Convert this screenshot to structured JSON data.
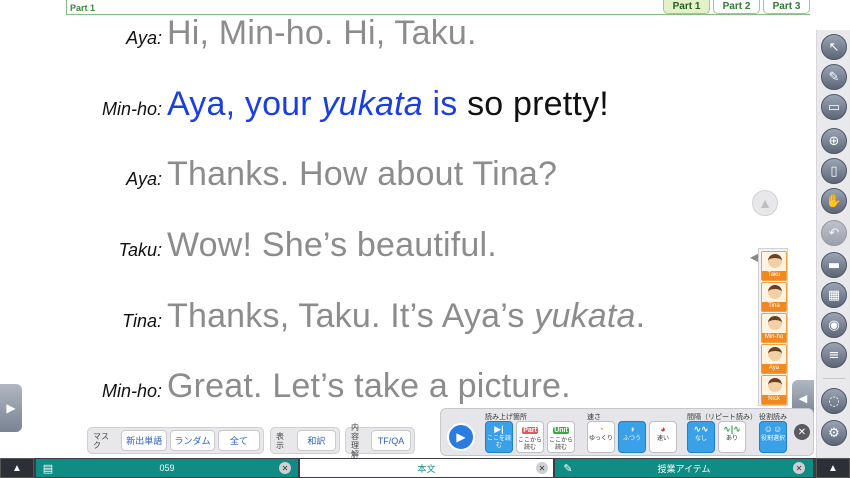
{
  "header": {
    "part_tag": "Part 1",
    "tabs": [
      {
        "label": "Part 1",
        "active": true
      },
      {
        "label": "Part 2",
        "active": false
      },
      {
        "label": "Part 3",
        "active": false
      }
    ]
  },
  "dialogue": [
    {
      "speaker": "Aya:",
      "text": "Hi, Min-ho.  Hi, Taku."
    },
    {
      "speaker": "Min-ho:",
      "parts": [
        "Aya, your ",
        "yukata",
        " is",
        " so pretty!"
      ]
    },
    {
      "speaker": "Aya:",
      "text": "Thanks.  How about Tina?"
    },
    {
      "speaker": "Taku:",
      "text": "Wow!  She’s beautiful."
    },
    {
      "speaker": "Tina:",
      "parts": [
        "Thanks, Taku.  It’s Aya’s ",
        "yukata",
        "."
      ]
    },
    {
      "speaker": "Min-ho:",
      "text": "Great.  Let’s take a picture."
    }
  ],
  "characters": [
    "Taku",
    "Tina",
    "Min-ho",
    "Aya",
    "Nick"
  ],
  "right_toolbar": [
    "pointer-icon",
    "pen-icon",
    "eraser-icon",
    "zoom-icon",
    "book-icon",
    "hand-icon",
    "undo-icon",
    "screen-icon",
    "photo-icon",
    "camera-icon",
    "list-icon"
  ],
  "tools": {
    "mask_label": "マスク",
    "mask_buttons": [
      "新出単語",
      "ランダム",
      "全て"
    ],
    "display_label": "表示",
    "display_button": "和訳",
    "content_label_1": "内容",
    "content_label_2": "理解",
    "content_button": "TF/QA"
  },
  "read_panel": {
    "section_range": "読み上げ箇所",
    "section_speed": "速さ",
    "section_interval": "間隔（リピート読み）",
    "section_role": "役割読み",
    "range_buttons": [
      {
        "icon": "▶|",
        "caption": "ここを読む",
        "selected": true
      },
      {
        "icon": "Part",
        "caption": "ここから読む",
        "selected": false
      },
      {
        "icon": "Unit",
        "caption": "ここから読む",
        "selected": false
      }
    ],
    "speed_buttons": [
      {
        "caption": "ゆっくり",
        "selected": false
      },
      {
        "caption": "ふつう",
        "selected": true
      },
      {
        "caption": "速い",
        "selected": false
      }
    ],
    "interval_buttons": [
      {
        "caption": "なし",
        "selected": true
      },
      {
        "caption": "あり",
        "selected": false
      }
    ],
    "role_button": {
      "caption": "役割選択",
      "selected": true
    }
  },
  "bottom_tabs": {
    "page": "059",
    "main": "本文",
    "items": "授業アイテム"
  }
}
